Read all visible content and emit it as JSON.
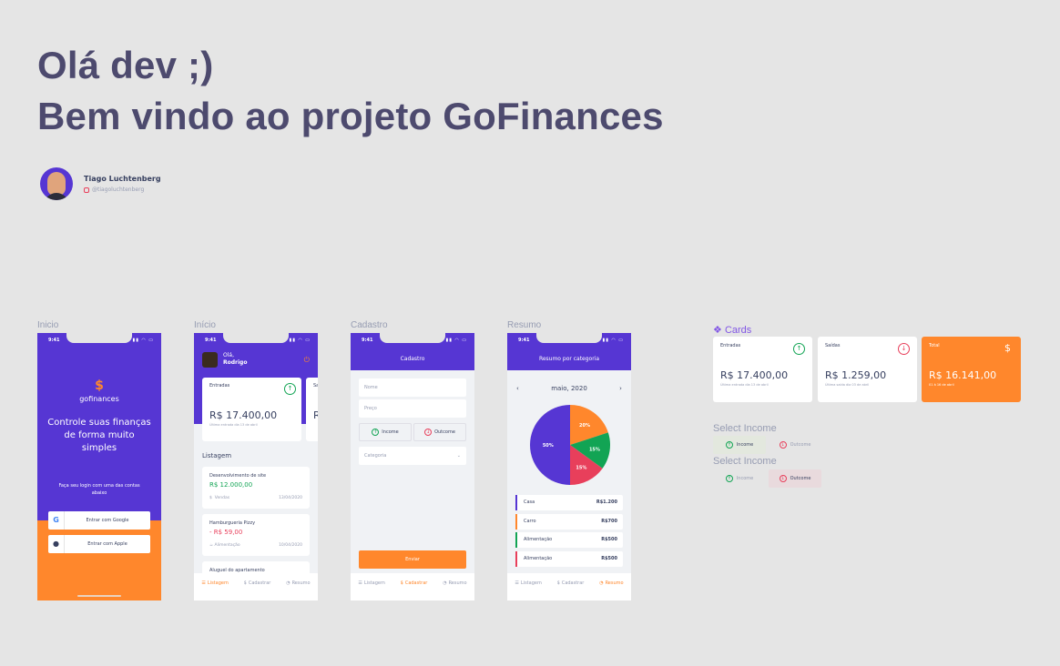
{
  "hero": {
    "line1": "Olá dev ;)",
    "line2": "Bem vindo ao projeto GoFinances"
  },
  "author": {
    "name": "Tiago Luchtenberg",
    "handle": "@tiagoluchtenberg"
  },
  "frames": {
    "inicio1": "Inicio",
    "inicio2": "Início",
    "cadastro": "Cadastro",
    "resumo": "Resumo"
  },
  "status": {
    "time": "9:41",
    "icons": "▮▮ ◠ ▭"
  },
  "login": {
    "logo_icon": "$",
    "brand": "gofinances",
    "title": "Controle suas finanças de forma muito simples",
    "subtitle": "Faça seu login com uma das contas abaixo",
    "google_icon": "G",
    "google": "Entrar com Google",
    "apple_icon": "",
    "apple": "Entrar com Apple"
  },
  "dashboard": {
    "greeting": "Olá,",
    "user": "Rodrigo",
    "power_icon": "⏻",
    "card": {
      "label": "Entradas",
      "amount": "R$ 17.400,00",
      "sub": "Última entrada dia 13 de abril",
      "icon": "↑"
    },
    "card_peek": {
      "label": "Sa",
      "amount": "R"
    },
    "list_title": "Listagem",
    "transactions": [
      {
        "title": "Desenvolvimento de site",
        "amount": "R$ 12.000,00",
        "category": "Vendas",
        "date": "13/04/2020",
        "icon": "$"
      },
      {
        "title": "Hamburgueria Pizzy",
        "amount": "- R$ 59,00",
        "category": "Alimentação",
        "date": "10/04/2020",
        "icon": "☕"
      },
      {
        "title": "Aluguel do apartamento",
        "amount": "",
        "category": "",
        "date": "",
        "icon": ""
      }
    ]
  },
  "tabs": {
    "listagem": "Listagem",
    "cadastrar": "Cadastrar",
    "resumo": "Resumo",
    "listagem_icon": "☰",
    "cadastrar_icon": "$",
    "resumo_icon": "◔"
  },
  "cadastro": {
    "title": "Cadastro",
    "nome_placeholder": "Nome",
    "preco_placeholder": "Preço",
    "income": "Income",
    "outcome": "Outcome",
    "income_icon": "↑",
    "outcome_icon": "↓",
    "categoria_placeholder": "Categoria",
    "chevron": "⌄",
    "send": "Enviar"
  },
  "resumo": {
    "title": "Resumo por categoria",
    "month": "maio, 2020",
    "prev": "‹",
    "next": "›",
    "slices": [
      {
        "label": "50%",
        "value": 50,
        "color": "#5636d3"
      },
      {
        "label": "20%",
        "value": 20,
        "color": "#ff872c"
      },
      {
        "label": "15%",
        "value": 15,
        "color": "#12a454"
      },
      {
        "label": "15%",
        "value": 15,
        "color": "#e83f5b"
      }
    ],
    "categories": [
      {
        "name": "Casa",
        "value": "R$1.200",
        "color": "#5636d3"
      },
      {
        "name": "Carro",
        "value": "R$700",
        "color": "#ff872c"
      },
      {
        "name": "Alimentação",
        "value": "R$500",
        "color": "#12a454"
      },
      {
        "name": "Alimentação",
        "value": "R$500",
        "color": "#e83f5b"
      }
    ]
  },
  "cards_panel": {
    "title": "Cards",
    "title_icon": "❖",
    "entradas": {
      "label": "Entradas",
      "amount": "R$ 17.400,00",
      "sub": "Última entrada dia 13 de abril",
      "icon": "↑"
    },
    "saidas": {
      "label": "Saídas",
      "amount": "R$ 1.259,00",
      "sub": "Última saída dia 03 de abril",
      "icon": "↓"
    },
    "total": {
      "label": "Total",
      "amount": "R$ 16.141,00",
      "sub": "01 à 16 de abril",
      "icon": "$"
    }
  },
  "select_income": {
    "title1": "Select Income",
    "title2": "Select Income",
    "income": "Income",
    "outcome": "Outcome",
    "income_icon": "↑",
    "outcome_icon": "↓"
  },
  "colors": {
    "primary": "#5636d3",
    "secondary": "#ff872c",
    "success": "#12a454",
    "attention": "#e83f5b",
    "background": "#f0f2f5",
    "title": "#363f5f",
    "text": "#969cb2"
  }
}
